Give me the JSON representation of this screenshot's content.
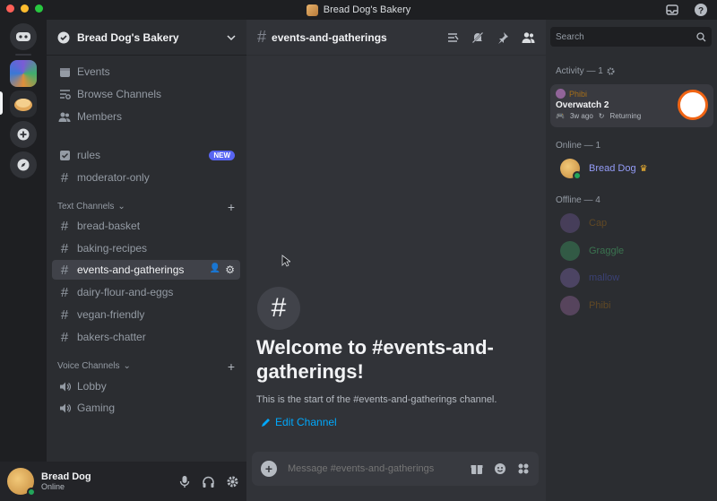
{
  "window": {
    "title": "Bread Dog's Bakery"
  },
  "guild": {
    "name": "Bread Dog's Bakery",
    "top_items": [
      {
        "label": "Events",
        "icon": "calendar-icon"
      },
      {
        "label": "Browse Channels",
        "icon": "browse-channels-icon"
      },
      {
        "label": "Members",
        "icon": "members-icon"
      }
    ],
    "pinned_channels": [
      {
        "label": "rules",
        "icon": "rules-icon",
        "badge": "NEW"
      },
      {
        "label": "moderator-only",
        "icon": "locked-channel-icon"
      }
    ],
    "text_category": "Text Channels",
    "text_channels": [
      "bread-basket",
      "baking-recipes",
      "events-and-gatherings",
      "dairy-flour-and-eggs",
      "vegan-friendly",
      "bakers-chatter"
    ],
    "active_channel_index": 2,
    "voice_category": "Voice Channels",
    "voice_channels": [
      "Lobby",
      "Gaming"
    ]
  },
  "user": {
    "name": "Bread Dog",
    "status": "Online"
  },
  "main": {
    "channel": "events-and-gatherings",
    "welcome_title": "Welcome to #events-and-gatherings!",
    "welcome_sub": "This is the start of the #events-and-gatherings channel.",
    "edit_link": "Edit Channel",
    "composer_placeholder": "Message #events-and-gatherings"
  },
  "members": {
    "search_placeholder": "Search",
    "activity_header": "Activity — 1",
    "activity": {
      "user": "Phibi",
      "game": "Overwatch 2",
      "ago": "3w ago",
      "tag": "Returning"
    },
    "online_header": "Online — 1",
    "online": [
      {
        "name": "Bread Dog",
        "color": "#949cf7"
      }
    ],
    "offline_header": "Offline — 4",
    "offline": [
      {
        "name": "Cap",
        "color": "#c27c0e"
      },
      {
        "name": "Graggle",
        "color": "#57f287"
      },
      {
        "name": "mallow",
        "color": "#5865f2"
      },
      {
        "name": "Phibi",
        "color": "#c27c0e"
      }
    ]
  },
  "colors": {
    "accent": "#5865f2",
    "online": "#23a55a",
    "link": "#00a8fc"
  }
}
